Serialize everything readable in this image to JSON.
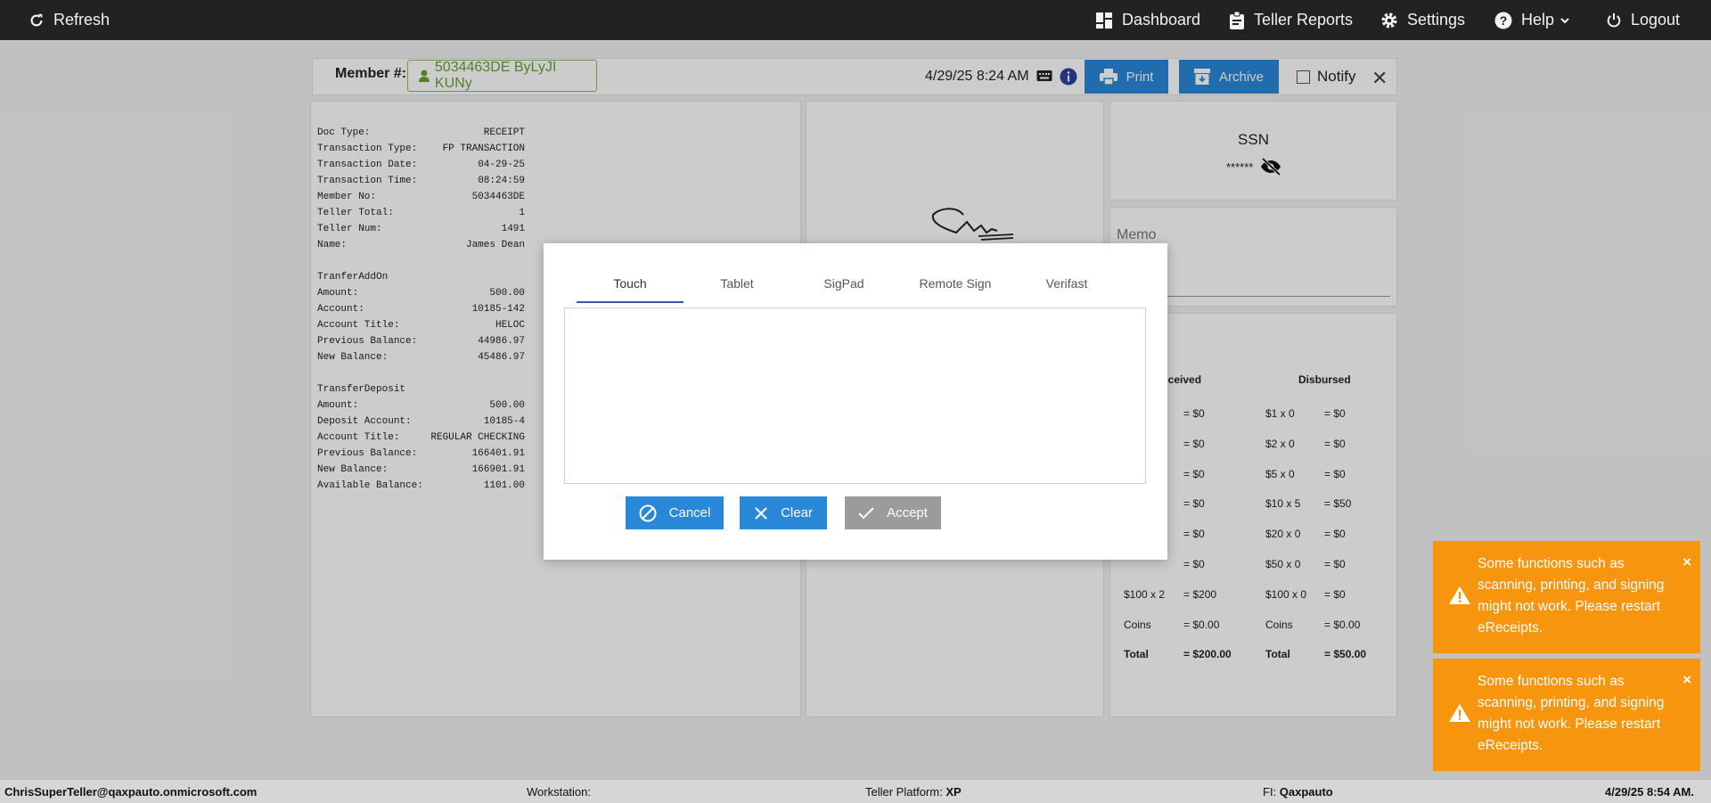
{
  "nav": {
    "refresh": "Refresh",
    "dashboard": "Dashboard",
    "teller_reports": "Teller Reports",
    "settings": "Settings",
    "help": "Help",
    "logout": "Logout"
  },
  "header": {
    "member_label": "Member #:",
    "member_value": "5034463DE ByLyJI KUNy",
    "datetime": "4/29/25 8:24 AM",
    "print": "Print",
    "archive": "Archive",
    "notify": "Notify"
  },
  "receipt": {
    "rows": [
      [
        "Doc Type:",
        "RECEIPT"
      ],
      [
        "Transaction Type:",
        "FP TRANSACTION"
      ],
      [
        "Transaction Date:",
        "04-29-25"
      ],
      [
        "Transaction Time:",
        "08:24:59"
      ],
      [
        "Member No:",
        "5034463DE"
      ],
      [
        "Teller Total:",
        "1"
      ],
      [
        "Teller Num:",
        "1491"
      ],
      [
        "Name:",
        "James Dean"
      ],
      [
        "",
        ""
      ],
      [
        "TranferAddOn",
        ""
      ],
      [
        "Amount:",
        "500.00"
      ],
      [
        "Account:",
        "10185-142"
      ],
      [
        "Account Title:",
        "HELOC"
      ],
      [
        "Previous Balance:",
        "44986.97"
      ],
      [
        "New Balance:",
        "45486.97"
      ],
      [
        "",
        ""
      ],
      [
        "TransferDeposit",
        ""
      ],
      [
        "Amount:",
        "500.00"
      ],
      [
        "Deposit Account:",
        "10185-4"
      ],
      [
        "Account Title:",
        "REGULAR CHECKING"
      ],
      [
        "Previous Balance:",
        "166401.91"
      ],
      [
        "New Balance:",
        "166901.91"
      ],
      [
        "Available Balance:",
        "1101.00"
      ]
    ]
  },
  "ssn": {
    "title": "SSN",
    "value": "******"
  },
  "memo": {
    "label": "Memo"
  },
  "cash": {
    "received_header": "eceived",
    "disbursed_header": "Disbursed",
    "rows": [
      {
        "r_label": "",
        "r_val": "= $0",
        "d_label": "$1 x 0",
        "d_val": "= $0"
      },
      {
        "r_label": "",
        "r_val": "= $0",
        "d_label": "$2 x 0",
        "d_val": "= $0"
      },
      {
        "r_label": "",
        "r_val": "= $0",
        "d_label": "$5 x 0",
        "d_val": "= $0"
      },
      {
        "r_label": "",
        "r_val": "= $0",
        "d_label": "$10 x 5",
        "d_val": "= $50"
      },
      {
        "r_label": "",
        "r_val": "= $0",
        "d_label": "$20 x 0",
        "d_val": "= $0"
      },
      {
        "r_label": "",
        "r_val": "= $0",
        "d_label": "$50 x 0",
        "d_val": "= $0"
      },
      {
        "r_label": "$100 x 2",
        "r_val": "= $200",
        "d_label": "$100 x 0",
        "d_val": "= $0"
      },
      {
        "r_label": "Coins",
        "r_val": "= $0.00",
        "d_label": "Coins",
        "d_val": "= $0.00"
      },
      {
        "r_label": "Total",
        "r_val": "= $200.00",
        "d_label": "Total",
        "d_val": "= $50.00"
      }
    ]
  },
  "modal": {
    "tabs": [
      "Touch",
      "Tablet",
      "SigPad",
      "Remote Sign",
      "Verifast"
    ],
    "active_tab": "Touch",
    "cancel": "Cancel",
    "clear": "Clear",
    "accept": "Accept"
  },
  "toasts": [
    "Some functions such as scanning, printing, and signing might not work. Please restart eReceipts.",
    "Some functions such as scanning, printing, and signing might not work. Please restart eReceipts."
  ],
  "footer": {
    "user": "ChrisSuperTeller@qaxpauto.onmicrosoft.com",
    "workstation_label": "Workstation:",
    "workstation_value": "",
    "platform_label": "Teller Platform:",
    "platform_value": "XP",
    "fi_label": "FI:",
    "fi_value": "Qaxpauto",
    "datetime": "4/29/25 8:54 AM."
  },
  "colors": {
    "topbar": "#222222",
    "primary_button": "#2a88d8",
    "toast": "#f7950f",
    "member_chip": "#6aa035",
    "tab_underline": "#3f51b5"
  }
}
